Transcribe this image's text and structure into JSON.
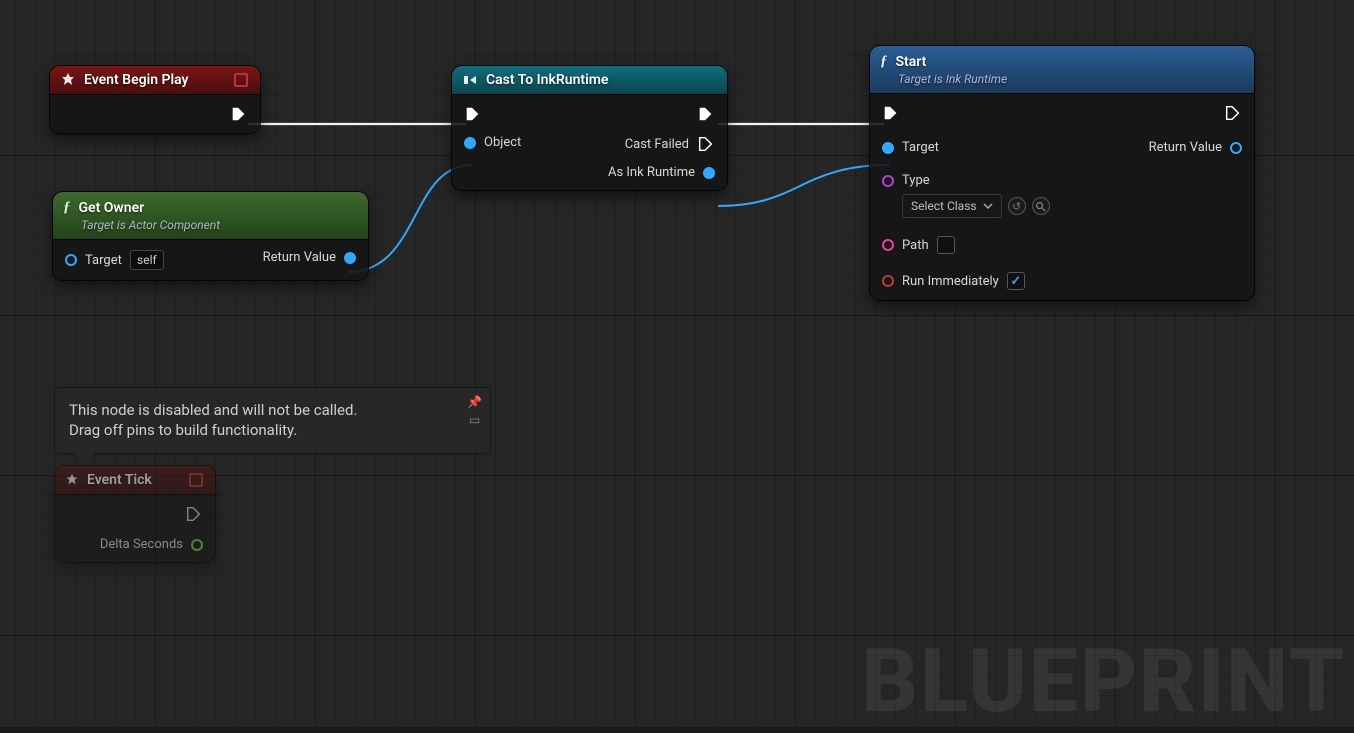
{
  "watermark": "BLUEPRINT",
  "note": {
    "line1": "This node is disabled and will not be called.",
    "line2": "Drag off pins to build functionality."
  },
  "nodes": {
    "beginPlay": {
      "title": "Event Begin Play"
    },
    "getOwner": {
      "title": "Get Owner",
      "subtitle": "Target is Actor Component",
      "pins": {
        "target": "Target",
        "self": "self",
        "return": "Return Value"
      }
    },
    "cast": {
      "title": "Cast To InkRuntime",
      "pins": {
        "object": "Object",
        "castFailed": "Cast Failed",
        "asInk": "As Ink Runtime"
      }
    },
    "start": {
      "title": "Start",
      "subtitle": "Target is Ink Runtime",
      "pins": {
        "target": "Target",
        "type": "Type",
        "selectClass": "Select Class",
        "path": "Path",
        "runImm": "Run Immediately",
        "return": "Return Value"
      }
    },
    "tick": {
      "title": "Event Tick",
      "pins": {
        "delta": "Delta Seconds"
      }
    }
  },
  "colors": {
    "execWire": "#ffffff",
    "dataWire": "#2fa8ff"
  }
}
